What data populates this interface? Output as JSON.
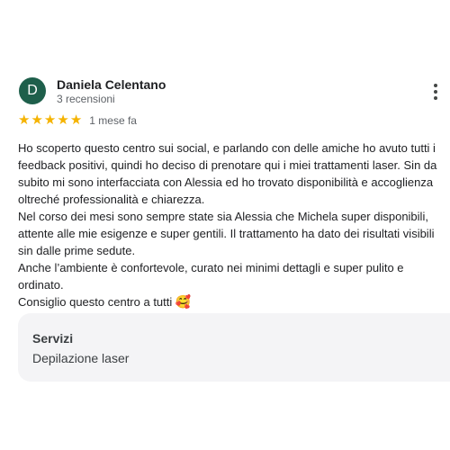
{
  "colors": {
    "avatar_bg": "#1e5f4b",
    "star": "#f5b301"
  },
  "review": {
    "avatar_initial": "D",
    "author": "Daniela Celentano",
    "author_reviews": "3 recensioni",
    "rating": 5,
    "rating_max": 5,
    "date": "1 mese fa",
    "paragraphs": [
      "Ho scoperto questo centro sui social, e parlando con delle amiche ho avuto tutti i feedback positivi, quindi ho deciso di prenotare qui i miei trattamenti laser. Sin da subito mi sono interfacciata con Alessia ed ho trovato disponibilità e accoglienza oltreché professionalità e chiarezza.",
      "Nel corso dei mesi sono sempre state sia Alessia che Michela super disponibili, attente alle mie esigenze e super gentili. Il trattamento ha dato dei risultati visibili sin dalle prime sedute.",
      "Anche l’ambiente è confortevole, curato nei minimi dettagli e super pulito e ordinato.",
      "Consiglio questo centro a tutti"
    ],
    "closing_emoji": "🥰",
    "more_icon": "more-vert-icon"
  },
  "services": {
    "title": "Servizi",
    "value": "Depilazione laser"
  }
}
